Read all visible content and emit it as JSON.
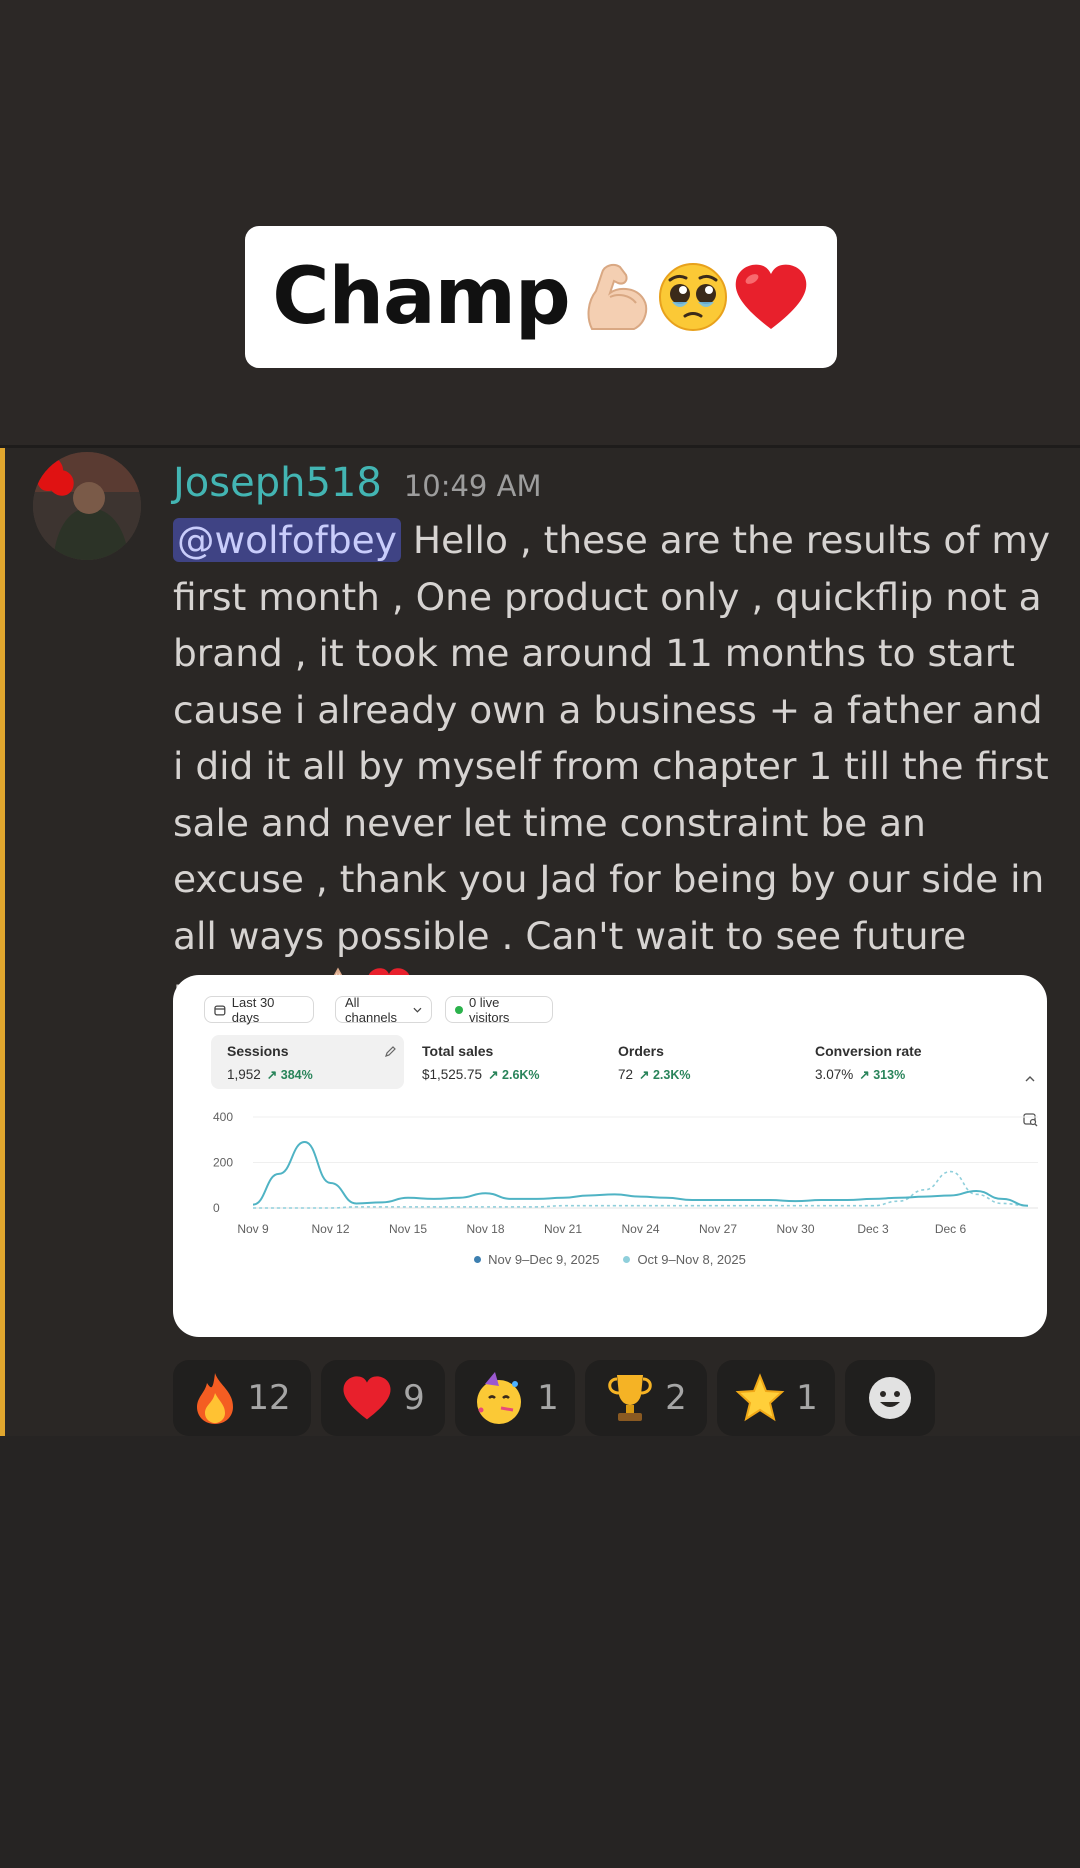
{
  "sticker": {
    "text": "Champ",
    "emojis": [
      "flexed-biceps-icon",
      "pleading-face-icon",
      "red-heart-icon"
    ]
  },
  "message": {
    "author": "Joseph518",
    "author_color": "#43b5b3",
    "timestamp": "10:49 AM",
    "mention": "@wolfofbey",
    "body": " Hello , these are the results of my first month , One product only , quickflip not a brand , it took me around 11 months to start cause i already own a business + a father and i did it all by myself from chapter 1 till the first sale and never let time constraint be an excuse , thank you Jad for being by our side in all ways possible . Can't wait to see future results",
    "trailing_emojis": [
      "folded-hands-icon",
      "red-heart-icon"
    ]
  },
  "dashboard": {
    "filters": {
      "date_range": "Last 30 days",
      "channels": "All channels",
      "live_visitors": "0 live visitors"
    },
    "metrics": [
      {
        "label": "Sessions",
        "value": "1,952",
        "delta": "384%"
      },
      {
        "label": "Total sales",
        "value": "$1,525.75",
        "delta": "2.6K%"
      },
      {
        "label": "Orders",
        "value": "72",
        "delta": "2.3K%"
      },
      {
        "label": "Conversion rate",
        "value": "3.07%",
        "delta": "313%"
      }
    ],
    "legend": {
      "current": "Nov 9–Dec 9, 2025",
      "previous": "Oct 9–Nov 8, 2025"
    },
    "colors": {
      "current": "#4fb3c4",
      "previous": "#8fcfdb",
      "delta": "#29845a"
    }
  },
  "chart_data": {
    "type": "line",
    "title": "",
    "xlabel": "",
    "ylabel": "",
    "ylim": [
      0,
      400
    ],
    "yticks": [
      "400",
      "200",
      "0"
    ],
    "xticks": [
      "Nov 9",
      "Nov 12",
      "Nov 15",
      "Nov 18",
      "Nov 21",
      "Nov 24",
      "Nov 27",
      "Nov 30",
      "Dec 3",
      "Dec 6"
    ],
    "x": [
      "Nov 9",
      "Nov 10",
      "Nov 11",
      "Nov 12",
      "Nov 13",
      "Nov 14",
      "Nov 15",
      "Nov 16",
      "Nov 17",
      "Nov 18",
      "Nov 19",
      "Nov 20",
      "Nov 21",
      "Nov 22",
      "Nov 23",
      "Nov 24",
      "Nov 25",
      "Nov 26",
      "Nov 27",
      "Nov 28",
      "Nov 29",
      "Nov 30",
      "Dec 1",
      "Dec 2",
      "Dec 3",
      "Dec 4",
      "Dec 5",
      "Dec 6",
      "Dec 7",
      "Dec 8",
      "Dec 9"
    ],
    "series": [
      {
        "name": "Nov 9–Dec 9, 2025",
        "values": [
          15,
          150,
          290,
          110,
          20,
          25,
          45,
          40,
          45,
          65,
          40,
          40,
          45,
          55,
          60,
          50,
          45,
          35,
          35,
          35,
          35,
          30,
          35,
          35,
          40,
          45,
          50,
          55,
          75,
          40,
          10
        ]
      },
      {
        "name": "Oct 9–Nov 8, 2025",
        "values": [
          0,
          0,
          0,
          0,
          5,
          5,
          5,
          5,
          5,
          5,
          5,
          5,
          10,
          10,
          10,
          10,
          10,
          10,
          10,
          10,
          10,
          10,
          10,
          10,
          10,
          30,
          80,
          160,
          60,
          20,
          10
        ]
      }
    ]
  },
  "reactions": [
    {
      "emoji": "fire-icon",
      "count": "12"
    },
    {
      "emoji": "red-heart-icon",
      "count": "9"
    },
    {
      "emoji": "partying-face-icon",
      "count": "1"
    },
    {
      "emoji": "trophy-icon",
      "count": "2"
    },
    {
      "emoji": "glowing-star-icon",
      "count": "1"
    },
    {
      "emoji": "add-reaction-icon",
      "count": ""
    }
  ]
}
